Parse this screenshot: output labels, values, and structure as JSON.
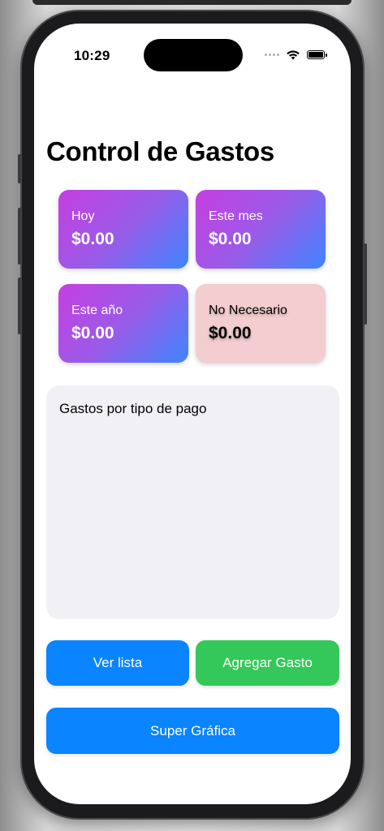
{
  "status_bar": {
    "time": "10:29"
  },
  "title": "Control de Gastos",
  "summary_cards": [
    {
      "label": "Hoy",
      "value": "$0.00",
      "style": "gradient"
    },
    {
      "label": "Este mes",
      "value": "$0.00",
      "style": "gradient"
    },
    {
      "label": "Este año",
      "value": "$0.00",
      "style": "gradient"
    },
    {
      "label": "No Necesario",
      "value": "$0.00",
      "style": "pink"
    }
  ],
  "chart_panel": {
    "title": "Gastos por tipo de pago"
  },
  "buttons": {
    "ver_lista": "Ver lista",
    "agregar_gasto": "Agregar Gasto",
    "super_grafica": "Super Gráfica"
  },
  "colors": {
    "card_gradient_start": "#c63ee0",
    "card_gradient_end": "#3d86ff",
    "card_pink": "#f3cdcf",
    "button_blue": "#0a84ff",
    "button_green": "#34c759",
    "panel_bg": "#f1f1f5"
  }
}
